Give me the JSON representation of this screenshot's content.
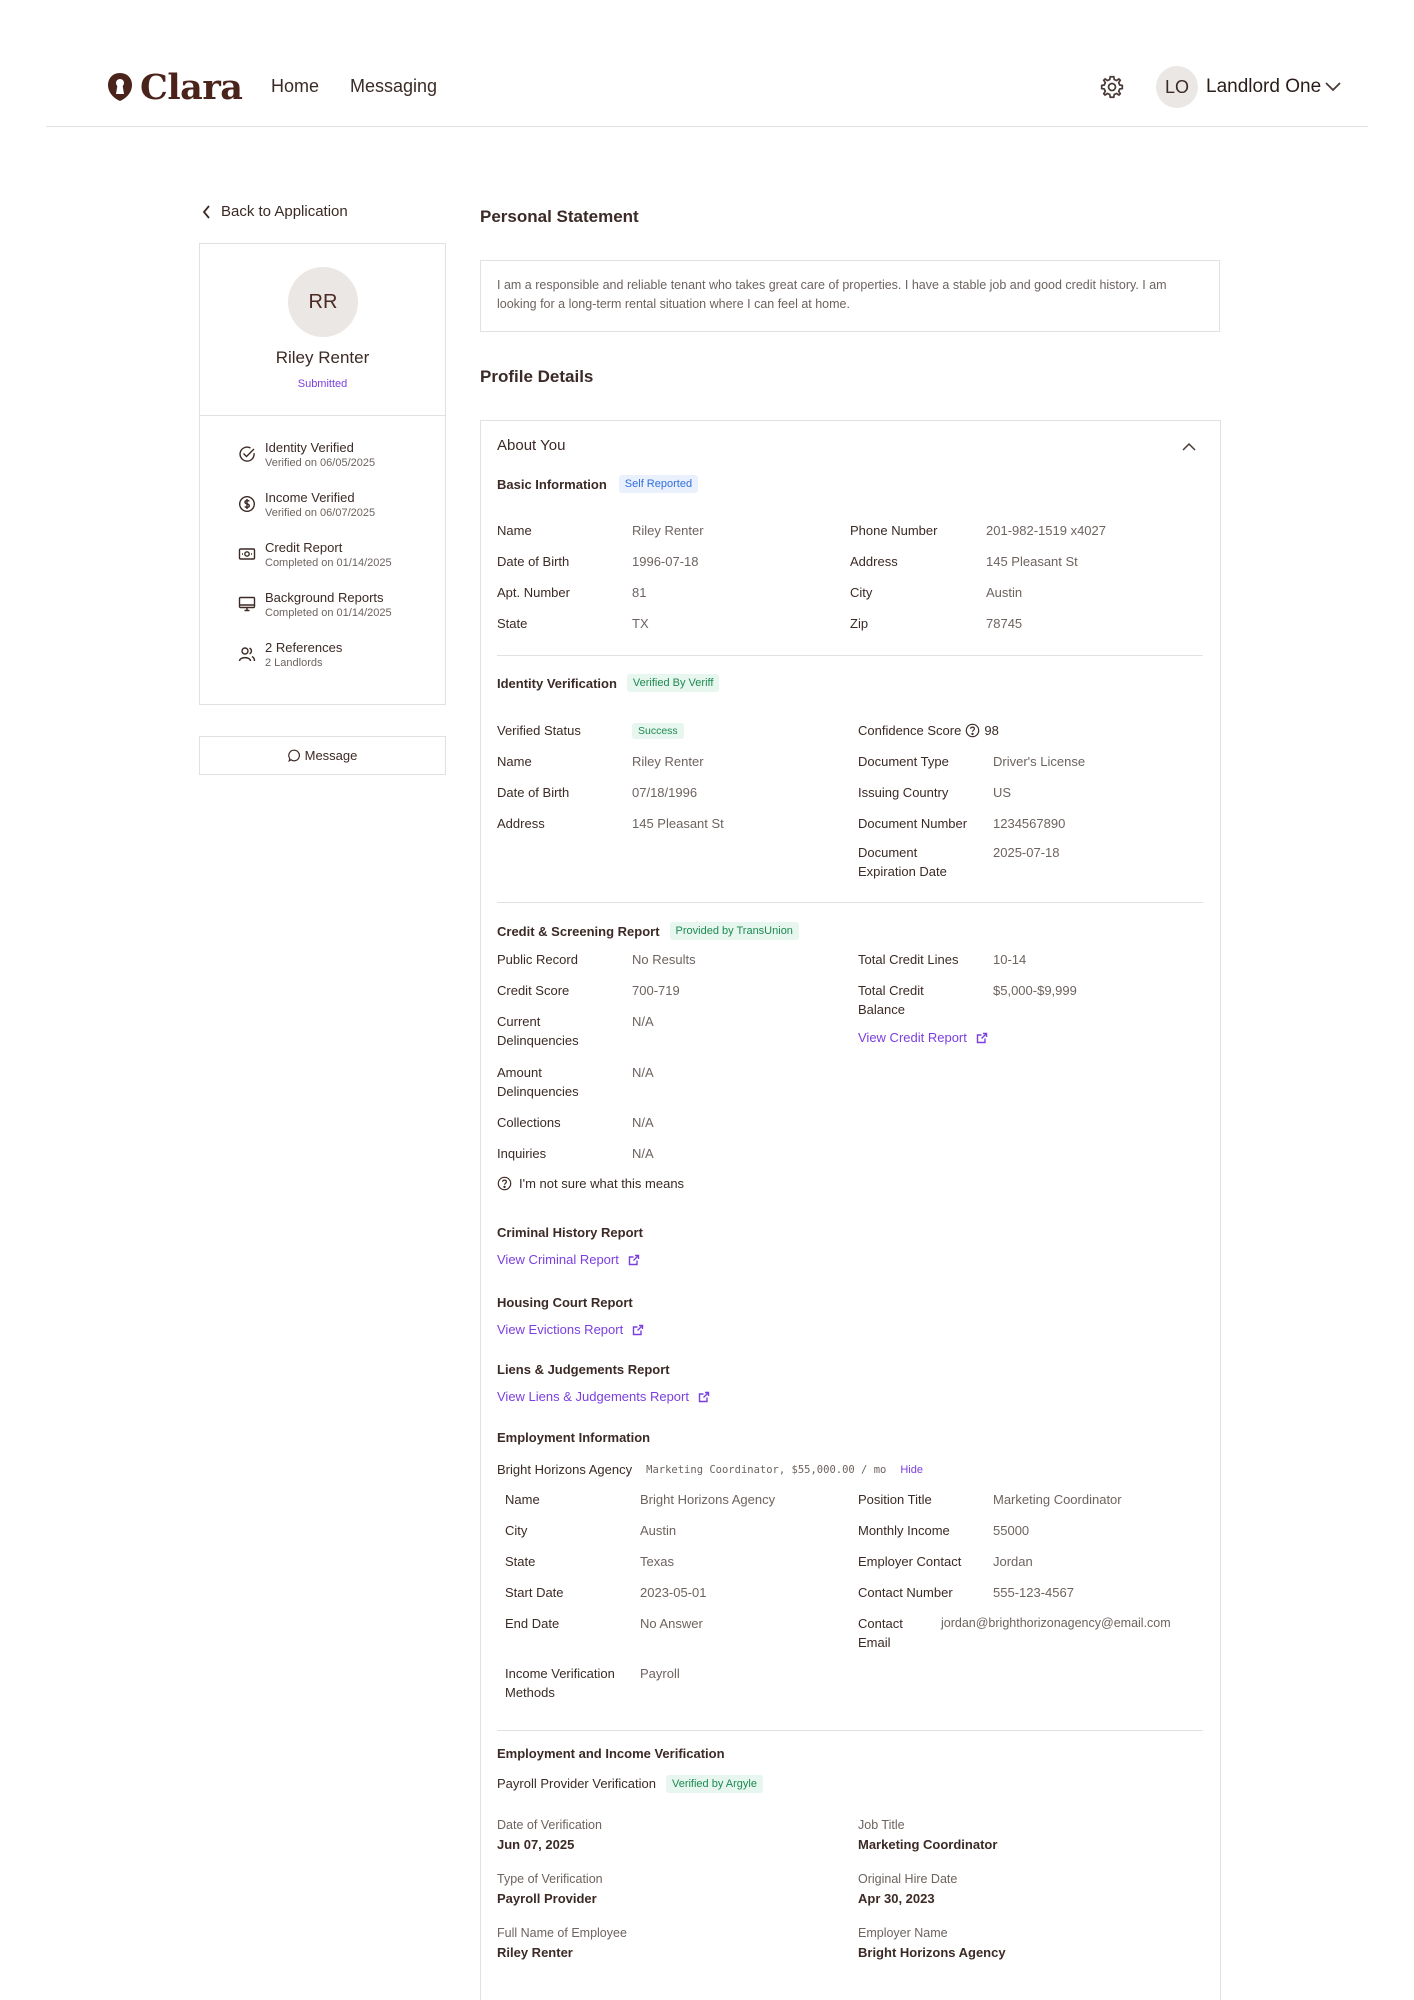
{
  "header": {
    "logo": "Clara",
    "nav": [
      "Home",
      "Messaging"
    ],
    "user_initials": "LO",
    "user_name": "Landlord One"
  },
  "sidebar": {
    "back_label": "Back to Application",
    "initials": "RR",
    "name": "Riley Renter",
    "status": "Submitted",
    "items": [
      {
        "icon": "check-circle-icon",
        "title": "Identity Verified",
        "sub": "Verified on 06/05/2025"
      },
      {
        "icon": "dollar-circle-icon",
        "title": "Income Verified",
        "sub": "Verified on 06/07/2025"
      },
      {
        "icon": "money-card-icon",
        "title": "Credit Report",
        "sub": "Completed on 01/14/2025"
      },
      {
        "icon": "monitor-icon",
        "title": "Background Reports",
        "sub": "Completed on 01/14/2025"
      },
      {
        "icon": "users-icon",
        "title": "2 References",
        "sub": "2 Landlords"
      }
    ],
    "message_label": "Message"
  },
  "statement": {
    "title": "Personal Statement",
    "text": "I am a responsible and reliable tenant who takes great care of properties. I have a stable job and good credit history. I am looking for a long-term rental situation where I can feel at home."
  },
  "profile": {
    "title": "Profile Details",
    "about": "About You",
    "basic": {
      "title": "Basic Information",
      "badge": "Self Reported",
      "left": [
        {
          "label": "Name",
          "value": "Riley Renter"
        },
        {
          "label": "Date of Birth",
          "value": "1996-07-18"
        },
        {
          "label": "Apt. Number",
          "value": "81"
        },
        {
          "label": "State",
          "value": "TX"
        }
      ],
      "right": [
        {
          "label": "Phone Number",
          "value": "201-982-1519 x4027"
        },
        {
          "label": "Address",
          "value": "145 Pleasant St"
        },
        {
          "label": "City",
          "value": "Austin"
        },
        {
          "label": "Zip",
          "value": "78745"
        }
      ]
    },
    "identity": {
      "title": "Identity Verification",
      "badge": "Verified By Veriff",
      "status_label": "Verified Status",
      "status_value": "Success",
      "left": [
        {
          "label": "Name",
          "value": "Riley Renter"
        },
        {
          "label": "Date of Birth",
          "value": "07/18/1996"
        },
        {
          "label": "Address",
          "value": "145 Pleasant St"
        }
      ],
      "confidence_label": "Confidence Score",
      "confidence_value": "98",
      "right": [
        {
          "label": "Document Type",
          "value": "Driver's License"
        },
        {
          "label": "Issuing Country",
          "value": "US"
        },
        {
          "label": "Document Number",
          "value": "1234567890"
        },
        {
          "label": "Document Expiration Date",
          "value": "2025-07-18"
        }
      ]
    },
    "credit": {
      "title": "Credit & Screening Report",
      "badge": "Provided by TransUnion",
      "left": [
        {
          "label": "Public Record",
          "value": "No Results"
        },
        {
          "label": "Credit Score",
          "value": "700-719"
        },
        {
          "label": "Current Delinquencies",
          "value": "N/A"
        },
        {
          "label": "Amount Delinquencies",
          "value": "N/A"
        },
        {
          "label": "Collections",
          "value": "N/A"
        },
        {
          "label": "Inquiries",
          "value": "N/A"
        }
      ],
      "right": [
        {
          "label": "Total Credit Lines",
          "value": "10-14"
        },
        {
          "label": "Total Credit Balance",
          "value": "$5,000-$9,999"
        }
      ],
      "view_link": "View Credit Report",
      "help": "I'm not sure what this means"
    },
    "criminal": {
      "title": "Criminal History Report",
      "link": "View Criminal Report"
    },
    "housing": {
      "title": "Housing Court Report",
      "link": "View Evictions Report"
    },
    "liens": {
      "title": "Liens & Judgements Report",
      "link": "View Liens & Judgements Report"
    },
    "employment": {
      "title": "Employment Information",
      "employer": "Bright Horizons Agency",
      "summary": "Marketing Coordinator, $55,000.00 / mo",
      "hide": "Hide",
      "left": [
        {
          "label": "Name",
          "value": "Bright Horizons Agency"
        },
        {
          "label": "City",
          "value": "Austin"
        },
        {
          "label": "State",
          "value": "Texas"
        },
        {
          "label": "Start Date",
          "value": "2023-05-01"
        },
        {
          "label": "End Date",
          "value": "No Answer"
        },
        {
          "label": "Income Verification Methods",
          "value": "Payroll"
        }
      ],
      "right": [
        {
          "label": "Position Title",
          "value": "Marketing Coordinator"
        },
        {
          "label": "Monthly Income",
          "value": "55000"
        },
        {
          "label": "Employer Contact",
          "value": "Jordan"
        },
        {
          "label": "Contact Number",
          "value": "555-123-4567"
        },
        {
          "label": "Contact Email",
          "value": "jordan@brighthorizonagency@email.com"
        }
      ]
    },
    "verification": {
      "title": "Employment and Income Verification",
      "provider": "Payroll Provider Verification",
      "badge": "Verified by Argyle",
      "left": [
        {
          "label": "Date of Verification",
          "value": "Jun 07, 2025"
        },
        {
          "label": "Type of Verification",
          "value": "Payroll Provider"
        },
        {
          "label": "Full Name of Employee",
          "value": "Riley Renter"
        }
      ],
      "right": [
        {
          "label": "Job Title",
          "value": "Marketing Coordinator"
        },
        {
          "label": "Original Hire Date",
          "value": "Apr 30, 2023"
        },
        {
          "label": "Employer Name",
          "value": "Bright Horizons Agency"
        }
      ]
    }
  }
}
